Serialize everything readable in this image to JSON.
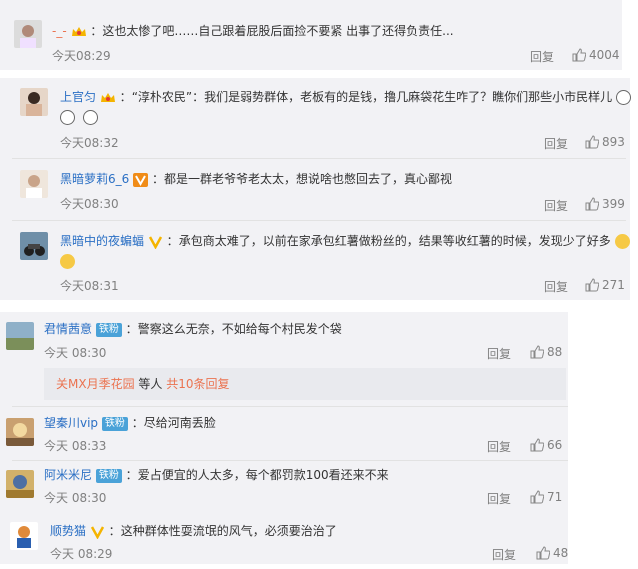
{
  "actions": {
    "reply": "回复"
  },
  "comments": [
    {
      "name": "-_-",
      "colon": "：",
      "text": "这也太惨了吧……自己跟着屁股后面捡不要紧 出事了还得负责任...",
      "time": "今天08:29",
      "likes": "4004"
    },
    {
      "name": "上官匀",
      "colon": "：",
      "text": "“淳朴农民”：我们是弱势群体，老板有的是钱，撸几麻袋花生咋了？瞧你们那些小市民样儿",
      "time": "今天08:32",
      "likes": "893"
    },
    {
      "name": "黑暗萝莉6_6",
      "colon": "：",
      "text": "都是一群老爷爷老太太，想说啥也憋回去了，真心鄙视",
      "time": "今天08:30",
      "likes": "399"
    },
    {
      "name": "黑暗中的夜蝙蝠",
      "colon": "：",
      "text": "承包商太难了，以前在家承包红薯做粉丝的，结果等收红薯的时候，发现少了好多",
      "time": "今天08:31",
      "likes": "271"
    },
    {
      "name": "君情茜意",
      "badge": "铁粉",
      "colon": "：",
      "text": "警察这么无奈，不如给每个村民发个袋",
      "time": "今天 08:30",
      "likes": "88"
    },
    {
      "name": "望秦川vip",
      "badge": "铁粉",
      "colon": "：",
      "text": "尽给河南丢脸",
      "time": "今天 08:33",
      "likes": "66"
    },
    {
      "name": "阿米米尼",
      "badge": "铁粉",
      "colon": "：",
      "text": "爱占便宜的人太多，每个都罚款100看还来不来",
      "time": "今天 08:30",
      "likes": "71"
    },
    {
      "name": "顺势猫",
      "colon": "：",
      "text": "这种群体性耍流氓的风气，必须要治治了",
      "time": "今天 08:29",
      "likes": "48"
    }
  ],
  "more_replies": {
    "users": "关MX月季花园",
    "suffix": " 等人 ",
    "count": "共10条回复"
  },
  "colors": {
    "name": "#eb7350",
    "accent_blue": "#2a6fc4",
    "panel": "#f2f2f5",
    "fan_badge": "#4aa2d8"
  }
}
